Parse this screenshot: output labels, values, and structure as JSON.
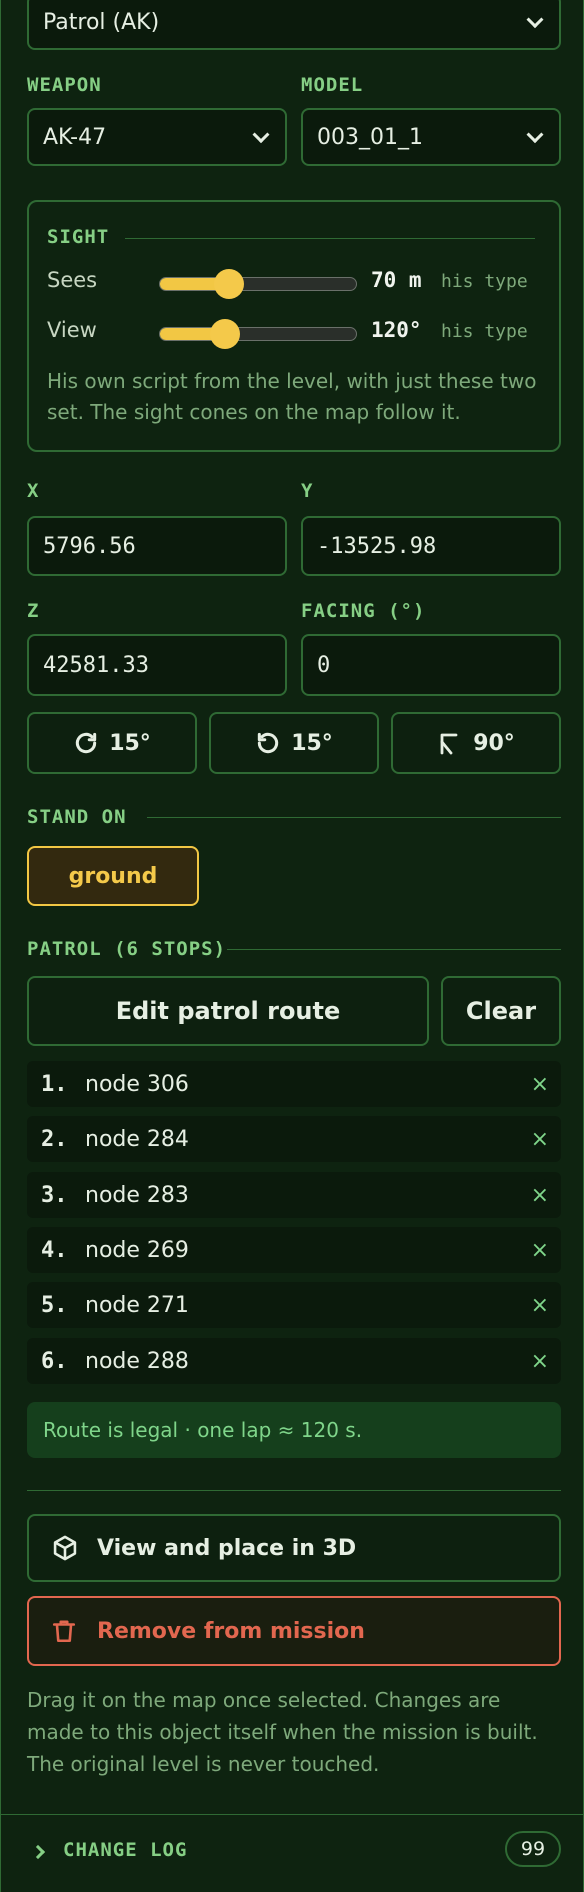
{
  "role_select": {
    "value": "Patrol (AK)"
  },
  "weapon": {
    "label": "WEAPON",
    "value": "AK-47"
  },
  "model": {
    "label": "MODEL",
    "value": "003_01_1"
  },
  "sight": {
    "title": "SIGHT",
    "sees": {
      "label": "Sees",
      "value": "70 m",
      "suffix": "his type",
      "level": 0.35
    },
    "view": {
      "label": "View",
      "value": "120°",
      "suffix": "his type",
      "level": 0.33
    },
    "note": "His own script from the level, with just these two set. The sight cones on the map follow it."
  },
  "coords": {
    "x": {
      "label": "X",
      "value": "5796.56"
    },
    "y": {
      "label": "Y",
      "value": "-13525.98"
    },
    "z": {
      "label": "Z",
      "value": "42581.33"
    },
    "facing": {
      "label": "FACING (°)",
      "value": "0"
    }
  },
  "rotate": {
    "cw": "15°",
    "ccw": "15°",
    "right": "90°"
  },
  "stand_on": {
    "label": "STAND ON",
    "value": "ground"
  },
  "patrol": {
    "title": "PATROL (6 STOPS)",
    "edit_label": "Edit patrol route",
    "clear_label": "Clear",
    "stops": [
      {
        "num": "1.",
        "name": "node 306"
      },
      {
        "num": "2.",
        "name": "node 284"
      },
      {
        "num": "3.",
        "name": "node 283"
      },
      {
        "num": "4.",
        "name": "node 269"
      },
      {
        "num": "5.",
        "name": "node 271"
      },
      {
        "num": "6.",
        "name": "node 288"
      }
    ],
    "remove_glyph": "×",
    "status": "Route is legal · one lap ≈ 120 s."
  },
  "actions": {
    "view3d": "View and place in 3D",
    "remove": "Remove from mission"
  },
  "footer_note": "Drag it on the map once selected. Changes are made to this object itself when the mission is built. The original level is never touched.",
  "changelog": {
    "label": "CHANGE LOG",
    "count": "99"
  },
  "colors": {
    "accent": "#f2c744",
    "border": "#2f6a34",
    "danger": "#e2674f",
    "label": "#86cf85"
  }
}
